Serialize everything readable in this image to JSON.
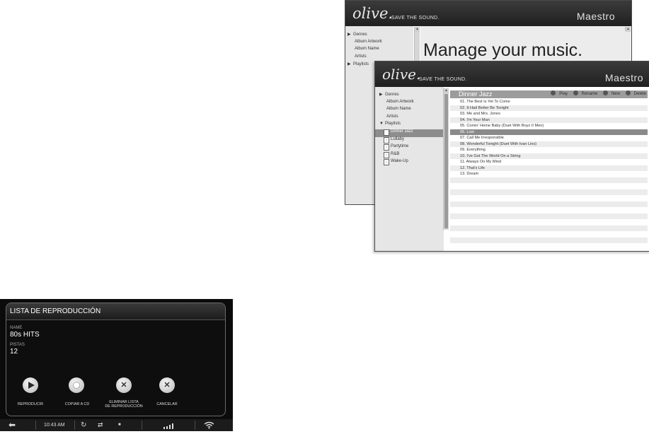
{
  "maestro_back": {
    "logo": "olive.",
    "tagline": "SAVE THE SOUND.",
    "product": "Maestro",
    "nav": [
      {
        "label": "Genres",
        "expander": "▶"
      },
      {
        "label": "Album Artwork",
        "expander": ""
      },
      {
        "label": "Album Name",
        "expander": ""
      },
      {
        "label": "Artists",
        "expander": ""
      },
      {
        "label": "Playlists",
        "expander": "▶"
      }
    ],
    "headline": "Manage your music."
  },
  "maestro_front": {
    "logo": "olive.",
    "tagline": "SAVE THE SOUND.",
    "product": "Maestro",
    "nav": [
      {
        "label": "Genres",
        "expander": "▶"
      },
      {
        "label": "Album Artwork",
        "expander": ""
      },
      {
        "label": "Album Name",
        "expander": ""
      },
      {
        "label": "Artists",
        "expander": ""
      },
      {
        "label": "Playlists",
        "expander": "▼"
      }
    ],
    "playlists": [
      "Dinner Jazz",
      "Lullaby",
      "Partytime",
      "R&B",
      "Wake-Up"
    ],
    "selected_playlist_index": 0,
    "playlist_title": "Dinner Jazz",
    "actions": [
      "Play",
      "Rename",
      "New",
      "Delete"
    ],
    "tracks": [
      "01. The Best Is Yet To Come",
      "02. It Had Better Be Tonight",
      "03. Me and Mrs. Jones",
      "04. I'm Your Man",
      "05. Comin' Home Baby (Duet With Boyz II Men)",
      "06. Lost",
      "07. Call Me Irresponsible",
      "08. Wonderful Tonight (Duet With Ivan Lins)",
      "09. Everything",
      "10. I've Got The World On a String",
      "11. Always On My Mind",
      "12. That's Life",
      "13. Dream"
    ],
    "selected_track_index": 5
  },
  "touch_panel": {
    "title": "LISTA DE REPRODUCCIÓN",
    "name_label": "NAME",
    "name_value": "80s HITS",
    "tracks_label": "PISTAS",
    "tracks_value": "12",
    "buttons": [
      {
        "label": "REPRODUCIR",
        "icon": "play-icon"
      },
      {
        "label": "COPIAR A CD",
        "icon": "record-icon"
      },
      {
        "label": "ELIMINAR LISTA\nDE REPRODUCCIÓN",
        "icon": "x-icon"
      },
      {
        "label": "CANCELAR",
        "icon": "x-icon"
      }
    ],
    "status": {
      "time": "10:43 AM",
      "back_icon": "back-arrow-icon",
      "repeat_icon": "repeat-icon",
      "shuffle_icon": "shuffle-icon",
      "stop_icon": "stop-icon",
      "signal_icon": "signal-bars-icon",
      "wifi_icon": "wifi-icon"
    }
  }
}
